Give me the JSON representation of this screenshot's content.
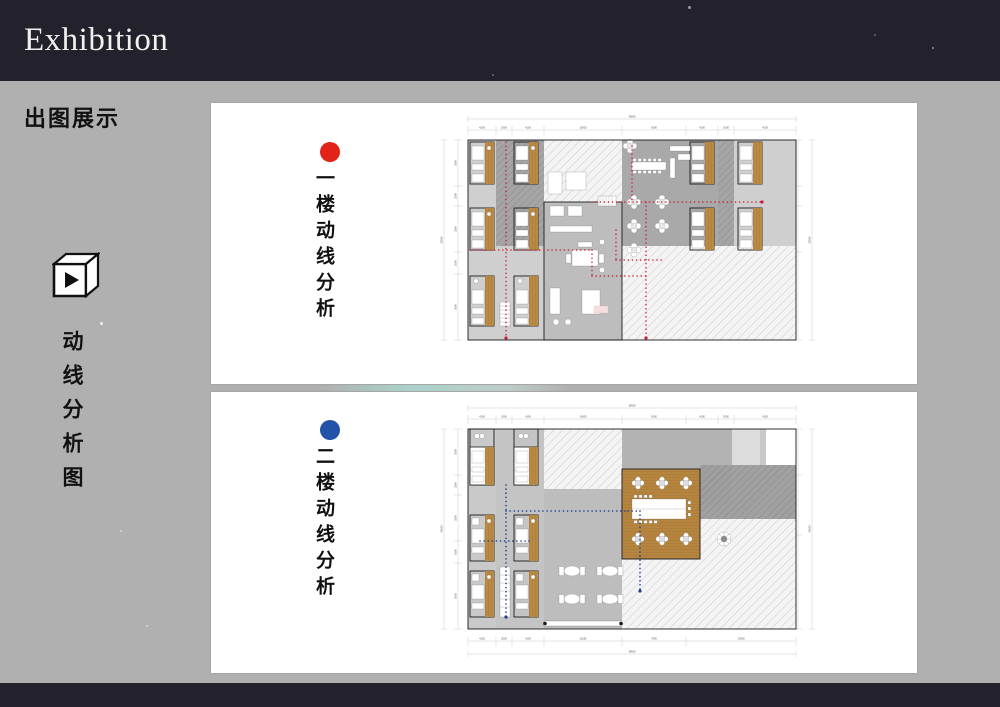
{
  "slide": {
    "header_title": "Exhibition",
    "section_title": "出图展示",
    "background_color": "#b0b0b0",
    "header_color": "#22212c"
  },
  "rail": {
    "icon": "cube-play-icon",
    "vertical_label": "动线分析图"
  },
  "panels": [
    {
      "id": "floor-1",
      "dot_color": "#e2231a",
      "caption": "一楼动线分析",
      "circulation_color": "#c8203c",
      "plan": {
        "total_width": "38000",
        "total_height": "33000",
        "top_dimensions": [
          "4100",
          "2000",
          "4100",
          "10000",
          "8100",
          "4100",
          "2000",
          "4100"
        ],
        "bottom_dimensions": [
          "4100",
          "2000",
          "4100",
          "10150",
          "7900",
          "4100",
          "2000",
          "4100"
        ],
        "left_dimensions": [
          "3300",
          "2300",
          "3300",
          "1600",
          "3500"
        ],
        "right_dimensions": [
          "3300",
          "2300",
          "3300",
          "16400"
        ]
      }
    },
    {
      "id": "floor-2",
      "dot_color": "#2253a8",
      "caption": "二楼动线分析",
      "circulation_color": "#1f3f96",
      "plan": {
        "total_width": "38000",
        "total_height": "33000",
        "top_dimensions": [
          "4100",
          "2000",
          "4100",
          "10000",
          "8100",
          "4100",
          "2000",
          "4100"
        ],
        "bottom_dimensions": [
          "4100",
          "2000",
          "4100",
          "10150",
          "7900",
          "10000"
        ],
        "left_dimensions": [
          "3300",
          "2300",
          "3300",
          "1600",
          "3500"
        ],
        "right_dimensions": [
          "3300",
          "6200",
          "10600"
        ]
      }
    }
  ]
}
